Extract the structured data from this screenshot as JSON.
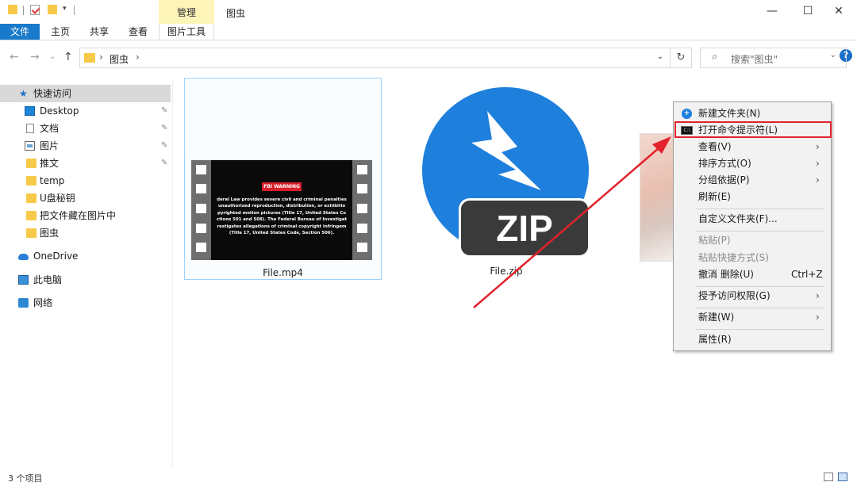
{
  "window": {
    "title": "图虫",
    "context_tab_group": "管理",
    "controls": {
      "minimize": "—",
      "maximize": "☐",
      "close": "✕"
    }
  },
  "ribbon": {
    "tabs": [
      "文件",
      "主页",
      "共享",
      "查看",
      "图片工具"
    ],
    "collapse_glyph": "⌄",
    "help_glyph": "?"
  },
  "address": {
    "back": "←",
    "forward": "→",
    "recent": "⌄",
    "up": "↑",
    "separator": "›",
    "crumb": "图虫",
    "dropdown": "⌄",
    "refresh": "↻",
    "search_icon": "⌕",
    "search_placeholder": "搜索\"图虫\""
  },
  "nav": {
    "quick_access": "快速访问",
    "pin_glyph": "✎",
    "items": [
      {
        "label": "Desktop",
        "icon": "desktop-icon",
        "pinned": true
      },
      {
        "label": "文档",
        "icon": "documents-icon",
        "pinned": true
      },
      {
        "label": "图片",
        "icon": "pictures-icon",
        "pinned": true
      },
      {
        "label": "推文",
        "icon": "folder-icon",
        "pinned": true
      },
      {
        "label": "temp",
        "icon": "folder-icon",
        "pinned": false
      },
      {
        "label": "U盘秘钥",
        "icon": "folder-icon",
        "pinned": false
      },
      {
        "label": "把文件藏在图片中",
        "icon": "folder-icon",
        "pinned": false
      },
      {
        "label": "图虫",
        "icon": "folder-icon",
        "pinned": false
      }
    ],
    "onedrive": "OneDrive",
    "this_pc": "此电脑",
    "network": "网络"
  },
  "files": [
    {
      "name": "File.mp4",
      "thumb_badge": "FBI WARNING",
      "thumb_text": "deral Law provides severe civil and criminal penalties\nunauthorized reproduction, distribution, or exhibitio\npyrighted motion pictures (Title 17, United States Co\nctions 501 and 508). The Federal Bureau of Investigat\nrestigates allegations of criminal copyright infringem\n(Title 17, United States Code, Section 506)."
    },
    {
      "name": "File.zip",
      "badge": "ZIP"
    }
  ],
  "context_menu": {
    "new_folder": "新建文件夹(N)",
    "open_cmd": "打开命令提示符(L)",
    "cmd_icon_text": "C:\\",
    "view": "查看(V)",
    "sort_by": "排序方式(O)",
    "group_by": "分组依据(P)",
    "refresh": "刷新(E)",
    "customize": "自定义文件夹(F)...",
    "paste": "粘贴(P)",
    "paste_shortcut": "粘贴快捷方式(S)",
    "undo_delete": "撤消 删除(U)",
    "undo_shortcut": "Ctrl+Z",
    "give_access": "授予访问权限(G)",
    "new": "新建(W)",
    "properties": "属性(R)",
    "submenu_glyph": "›"
  },
  "status": {
    "item_count": "3 个项目"
  },
  "colors": {
    "accent": "#1979ca",
    "highlight": "#e3212b",
    "arrow": "#e3212b"
  }
}
